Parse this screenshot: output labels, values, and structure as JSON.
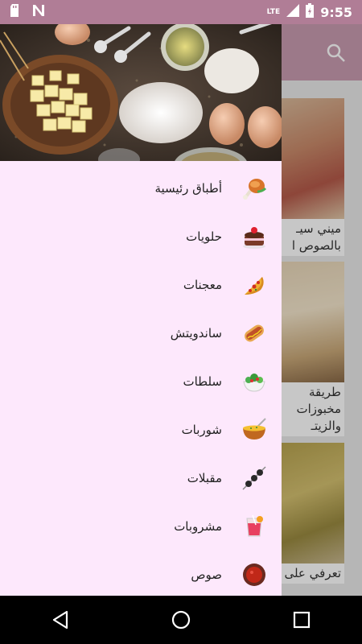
{
  "status_bar": {
    "network": "LTE",
    "time": "9:55"
  },
  "drawer": {
    "items": [
      {
        "label": "أطباق رئيسية",
        "icon": "chicken-leg-icon"
      },
      {
        "label": "حلويات",
        "icon": "cake-icon"
      },
      {
        "label": "معجنات",
        "icon": "pizza-icon"
      },
      {
        "label": "ساندويتش",
        "icon": "hotdog-icon"
      },
      {
        "label": "سلطات",
        "icon": "salad-icon"
      },
      {
        "label": "شوربات",
        "icon": "soup-bowl-icon"
      },
      {
        "label": "مقبلات",
        "icon": "skewer-icon"
      },
      {
        "label": "مشروبات",
        "icon": "drink-glass-icon"
      },
      {
        "label": "صوص",
        "icon": "sauce-bowl-icon"
      }
    ]
  },
  "background_cards": [
    {
      "caption_lines": [
        "ميني سيـ",
        "بالصوص ا"
      ]
    },
    {
      "caption_lines": [
        "طريقة",
        "مخبوزات",
        "والزيتـ"
      ]
    },
    {
      "caption_lines": [
        "تعرفي على"
      ]
    }
  ],
  "colors": {
    "status_bar": "#b07d96",
    "app_bar": "#c89bb0",
    "drawer_bg": "#fde8fc"
  }
}
